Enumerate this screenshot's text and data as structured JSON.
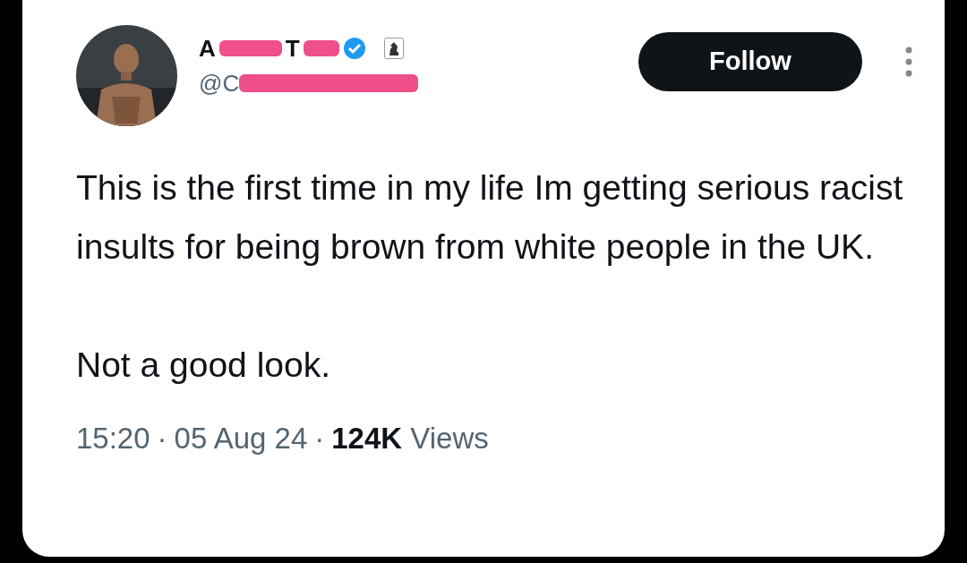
{
  "tweet": {
    "author": {
      "name_visible": [
        "A",
        "T"
      ],
      "verified": true,
      "handle": "@C"
    },
    "follow_button": "Follow",
    "paragraphs": [
      "This is the first time in my life Im getting serious racist insults for being brown from white people in the UK.",
      "Not a good look."
    ],
    "footer": {
      "time": "15:20",
      "sep_1": "·",
      "date": "05 Aug 24",
      "sep_2": "·",
      "views_count": "124K",
      "views_label": "Views"
    }
  }
}
